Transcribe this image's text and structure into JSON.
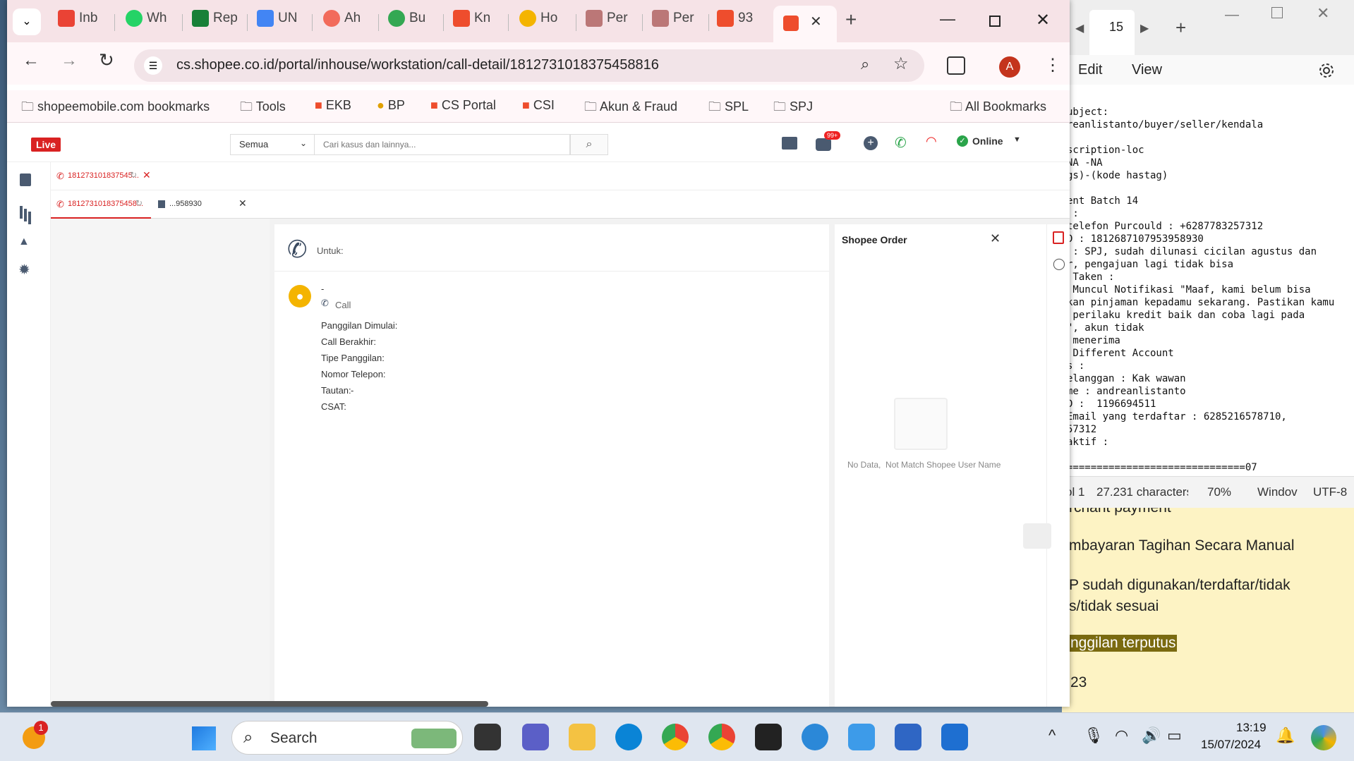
{
  "browser": {
    "tabs": [
      "Inb",
      "Wh",
      "Rep",
      "UN",
      "Ah",
      "Bu",
      "Kn",
      "Ho",
      "Per",
      "Per",
      "93"
    ],
    "url": "cs.shopee.co.id/portal/inhouse/workstation/call-detail/1812731018375458816",
    "profile_initial": "A",
    "bookmarks": [
      "shopeemobile.com bookmarks",
      "Tools",
      "EKB",
      "BP",
      "CS Portal",
      "CSI",
      "Akun & Fraud",
      "SPL",
      "SPJ"
    ],
    "all_bookmarks": "All Bookmarks"
  },
  "app": {
    "live_badge": "Live",
    "filter_value": "Semua",
    "search_placeholder": "Cari kasus dan lainnya...",
    "notif_count": "99+",
    "status": "Online",
    "tab1_label": "181273101837545...",
    "tab2a_label": "1812731018375458...",
    "tab2b_label": "...958930",
    "call": {
      "to_label": "Untuk:",
      "name": "-",
      "type": "Call",
      "fields": [
        "Panggilan Dimulai:",
        "Call Berakhir:",
        "Tipe Panggilan:",
        "Nomor Telepon:",
        "Tautan:",
        "CSAT:"
      ],
      "tautan_value": "-"
    },
    "order": {
      "title": "Shopee Order",
      "empty": "No Data,  Not Match Shopee User Name"
    }
  },
  "notepad": {
    "tab_label": "15",
    "menu": [
      "Edit",
      "View"
    ],
    "lines": [
      "ubject:",
      "reanlistanto/buyer/seller/kendala",
      "",
      "scription-loc",
      "NA -NA",
      "gs)-(kode hastag)",
      "",
      "ent Batch 14",
      " :",
      "telefon Purcould : +6287783257312",
      "D : 1812687107953958930",
      " : SPJ, sudah dilunasi cicilan agustus dan",
      "r, pengajuan lagi tidak bisa",
      " Taken :",
      " Muncul Notifikasi \"Maaf, kami belum bisa",
      "kan pinjaman kepadamu sekarang. Pastikan kamu",
      " perilaku kredit baik dan coba lagi pada",
      "\", akun tidak",
      " menerima",
      " Different Account",
      "s :",
      "elanggan : Kak wawan",
      "me : andreanlistanto",
      "D :  1196694511",
      "Email yang terdaftar : 6285216578710,",
      "57312",
      "aktif :",
      "",
      "==============================07"
    ],
    "status": {
      "col": "ol 1",
      "chars": "27.231 characters",
      "zoom": "70%",
      "eol": "Windov",
      "enc": "UTF-8"
    }
  },
  "sticky": {
    "lines": [
      "rchant payment",
      "mbayaran Tagihan Secara Manual",
      "P sudah digunakan/terdaftar/tidak",
      "s/tidak sesuai",
      "nggilan terputus",
      "23"
    ]
  },
  "taskbar": {
    "search": "Search",
    "time": "13:19",
    "date": "15/07/2024",
    "badge": "1"
  }
}
